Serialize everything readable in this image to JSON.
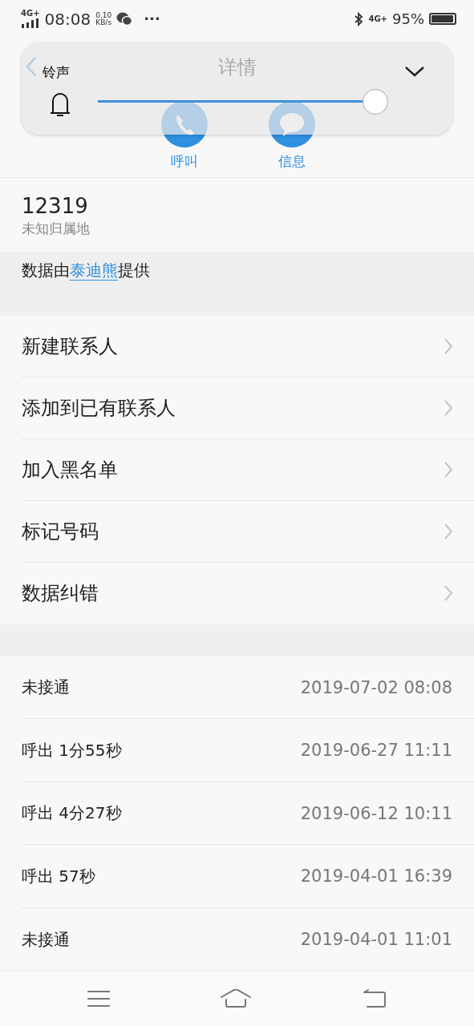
{
  "status_bar": {
    "network": "4G+",
    "time": "08:08",
    "speed_value": "0.10",
    "speed_unit": "KB/s",
    "more": "···",
    "network_right": "4G+",
    "battery": "95%"
  },
  "header": {
    "title": "详情"
  },
  "actions": [
    {
      "kind": "call",
      "label": "呼叫"
    },
    {
      "kind": "message",
      "label": "信息"
    }
  ],
  "volume_panel": {
    "label": "铃声",
    "level": 0.96
  },
  "number": {
    "value": "12319",
    "location": "未知归属地"
  },
  "source": {
    "prefix": "数据由",
    "link": "泰迪熊",
    "suffix": "提供"
  },
  "menu": [
    {
      "label": "新建联系人"
    },
    {
      "label": "添加到已有联系人"
    },
    {
      "label": "加入黑名单"
    },
    {
      "label": "标记号码"
    },
    {
      "label": "数据纠错"
    }
  ],
  "call_log": [
    {
      "type": "未接通",
      "time": "2019-07-02 08:08"
    },
    {
      "type": "呼出 1分55秒",
      "time": "2019-06-27 11:11"
    },
    {
      "type": "呼出 4分27秒",
      "time": "2019-06-12 10:11"
    },
    {
      "type": "呼出 57秒",
      "time": "2019-04-01 16:39"
    },
    {
      "type": "未接通",
      "time": "2019-04-01 11:01"
    }
  ]
}
